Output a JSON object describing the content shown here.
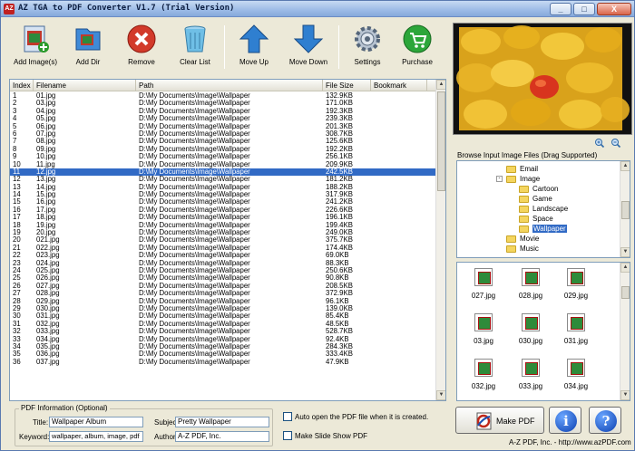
{
  "window": {
    "title": "AZ TGA to PDF Converter V1.7 (Trial Version)",
    "app_icon": "AZ",
    "buttons": {
      "minimize": "_",
      "maximize": "□",
      "close": "X"
    }
  },
  "toolbar": {
    "items": [
      {
        "label": "Add Image(s)",
        "icon": "add-images-icon"
      },
      {
        "label": "Add Dir",
        "icon": "add-dir-icon"
      },
      {
        "label": "Remove",
        "icon": "remove-icon"
      },
      {
        "label": "Clear List",
        "icon": "trash-icon"
      },
      {
        "label": "Move Up",
        "icon": "arrow-up-icon"
      },
      {
        "label": "Move Down",
        "icon": "arrow-down-icon"
      },
      {
        "label": "Settings",
        "icon": "gear-icon"
      },
      {
        "label": "Purchase",
        "icon": "cart-icon"
      }
    ]
  },
  "file_list": {
    "columns": [
      "Index",
      "Filename",
      "Path",
      "File Size",
      "Bookmark"
    ],
    "selected_index": 10,
    "rows": [
      [
        "1",
        "01.jpg",
        "D:\\My Documents\\Image\\Wallpaper",
        "132.9KB"
      ],
      [
        "2",
        "03.jpg",
        "D:\\My Documents\\Image\\Wallpaper",
        "171.0KB"
      ],
      [
        "3",
        "04.jpg",
        "D:\\My Documents\\Image\\Wallpaper",
        "192.3KB"
      ],
      [
        "4",
        "05.jpg",
        "D:\\My Documents\\Image\\Wallpaper",
        "239.3KB"
      ],
      [
        "5",
        "06.jpg",
        "D:\\My Documents\\Image\\Wallpaper",
        "201.3KB"
      ],
      [
        "6",
        "07.jpg",
        "D:\\My Documents\\Image\\Wallpaper",
        "308.7KB"
      ],
      [
        "7",
        "08.jpg",
        "D:\\My Documents\\Image\\Wallpaper",
        "125.6KB"
      ],
      [
        "8",
        "09.jpg",
        "D:\\My Documents\\Image\\Wallpaper",
        "192.2KB"
      ],
      [
        "9",
        "10.jpg",
        "D:\\My Documents\\Image\\Wallpaper",
        "256.1KB"
      ],
      [
        "10",
        "11.jpg",
        "D:\\My Documents\\Image\\Wallpaper",
        "209.9KB"
      ],
      [
        "11",
        "12.jpg",
        "D:\\My Documents\\Image\\Wallpaper",
        "242.5KB"
      ],
      [
        "12",
        "13.jpg",
        "D:\\My Documents\\Image\\Wallpaper",
        "181.2KB"
      ],
      [
        "13",
        "14.jpg",
        "D:\\My Documents\\Image\\Wallpaper",
        "188.2KB"
      ],
      [
        "14",
        "15.jpg",
        "D:\\My Documents\\Image\\Wallpaper",
        "317.9KB"
      ],
      [
        "15",
        "16.jpg",
        "D:\\My Documents\\Image\\Wallpaper",
        "241.2KB"
      ],
      [
        "16",
        "17.jpg",
        "D:\\My Documents\\Image\\Wallpaper",
        "226.6KB"
      ],
      [
        "17",
        "18.jpg",
        "D:\\My Documents\\Image\\Wallpaper",
        "196.1KB"
      ],
      [
        "18",
        "19.jpg",
        "D:\\My Documents\\Image\\Wallpaper",
        "199.4KB"
      ],
      [
        "19",
        "20.jpg",
        "D:\\My Documents\\Image\\Wallpaper",
        "249.0KB"
      ],
      [
        "20",
        "021.jpg",
        "D:\\My Documents\\Image\\Wallpaper",
        "375.7KB"
      ],
      [
        "21",
        "022.jpg",
        "D:\\My Documents\\Image\\Wallpaper",
        "174.4KB"
      ],
      [
        "22",
        "023.jpg",
        "D:\\My Documents\\Image\\Wallpaper",
        "69.0KB"
      ],
      [
        "23",
        "024.jpg",
        "D:\\My Documents\\Image\\Wallpaper",
        "88.3KB"
      ],
      [
        "24",
        "025.jpg",
        "D:\\My Documents\\Image\\Wallpaper",
        "250.6KB"
      ],
      [
        "25",
        "026.jpg",
        "D:\\My Documents\\Image\\Wallpaper",
        "90.8KB"
      ],
      [
        "26",
        "027.jpg",
        "D:\\My Documents\\Image\\Wallpaper",
        "208.5KB"
      ],
      [
        "27",
        "028.jpg",
        "D:\\My Documents\\Image\\Wallpaper",
        "372.9KB"
      ],
      [
        "28",
        "029.jpg",
        "D:\\My Documents\\Image\\Wallpaper",
        "96.1KB"
      ],
      [
        "29",
        "030.jpg",
        "D:\\My Documents\\Image\\Wallpaper",
        "139.0KB"
      ],
      [
        "30",
        "031.jpg",
        "D:\\My Documents\\Image\\Wallpaper",
        "85.4KB"
      ],
      [
        "31",
        "032.jpg",
        "D:\\My Documents\\Image\\Wallpaper",
        "48.5KB"
      ],
      [
        "32",
        "033.jpg",
        "D:\\My Documents\\Image\\Wallpaper",
        "528.7KB"
      ],
      [
        "33",
        "034.jpg",
        "D:\\My Documents\\Image\\Wallpaper",
        "92.4KB"
      ],
      [
        "34",
        "035.jpg",
        "D:\\My Documents\\Image\\Wallpaper",
        "284.3KB"
      ],
      [
        "35",
        "036.jpg",
        "D:\\My Documents\\Image\\Wallpaper",
        "333.4KB"
      ],
      [
        "36",
        "037.jpg",
        "D:\\My Documents\\Image\\Wallpaper",
        "47.9KB"
      ]
    ]
  },
  "browser": {
    "title": "Browse Input Image Files (Drag Supported)",
    "tree": [
      {
        "label": "Email",
        "level": 0,
        "expander": ""
      },
      {
        "label": "Image",
        "level": 0,
        "expander": "-"
      },
      {
        "label": "Cartoon",
        "level": 1,
        "expander": ""
      },
      {
        "label": "Game",
        "level": 1,
        "expander": ""
      },
      {
        "label": "Landscape",
        "level": 1,
        "expander": ""
      },
      {
        "label": "Space",
        "level": 1,
        "expander": ""
      },
      {
        "label": "Wallpaper",
        "level": 1,
        "expander": "",
        "selected": true
      },
      {
        "label": "Movie",
        "level": 0,
        "expander": ""
      },
      {
        "label": "Music",
        "level": 0,
        "expander": ""
      }
    ]
  },
  "thumbnails": [
    "027.jpg",
    "028.jpg",
    "029.jpg",
    "03.jpg",
    "030.jpg",
    "031.jpg",
    "032.jpg",
    "033.jpg",
    "034.jpg"
  ],
  "pdf_info": {
    "legend": "PDF Information (Optional)",
    "title_label": "Title:",
    "title_value": "Wallpaper Album",
    "subject_label": "Subject:",
    "subject_value": "Pretty Wallpaper",
    "keyword_label": "Keyword:",
    "keyword_value": "wallpaper, album, image, pdf",
    "author_label": "Author:",
    "author_value": "A-Z PDF, Inc."
  },
  "options": {
    "auto_open": "Auto open the PDF file when it is created.",
    "slide_show": "Make Slide Show PDF"
  },
  "actions": {
    "make_pdf": "Make PDF",
    "info": "i",
    "help": "?"
  },
  "footer": {
    "copyright": "A-Z PDF, Inc. - http://www.azPDF.com"
  },
  "colors": {
    "selection": "#316ac5",
    "window_bg": "#ece9d8",
    "titlebar": "#9cbbe6"
  }
}
